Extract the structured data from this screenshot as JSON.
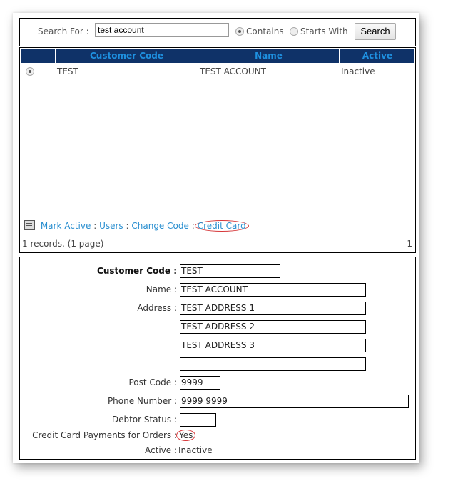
{
  "search": {
    "label": "Search For :",
    "value": "test account",
    "options": [
      {
        "label": "Contains",
        "selected": true
      },
      {
        "label": "Starts With",
        "selected": false
      }
    ],
    "button": "Search"
  },
  "grid": {
    "columns": [
      "Customer Code",
      "Name",
      "Active"
    ],
    "rows": [
      {
        "selected": true,
        "code": "TEST",
        "name": "TEST ACCOUNT",
        "active": "Inactive"
      }
    ],
    "actions": [
      "Mark Active",
      "Users",
      "Change Code",
      "Credit Card"
    ],
    "separator": ":",
    "records": "1 records. (1 page)",
    "page": "1"
  },
  "form": {
    "customer_code": {
      "label": "Customer Code :",
      "value": "TEST"
    },
    "name": {
      "label": "Name :",
      "value": "TEST ACCOUNT"
    },
    "address": {
      "label": "Address :",
      "lines": [
        "TEST ADDRESS 1",
        "TEST ADDRESS 2",
        "TEST ADDRESS 3",
        ""
      ]
    },
    "post_code": {
      "label": "Post Code :",
      "value": "9999"
    },
    "phone": {
      "label": "Phone Number :",
      "value": "9999 9999"
    },
    "debtor_status": {
      "label": "Debtor Status :",
      "value": ""
    },
    "cc_payments": {
      "label": "Credit Card Payments for Orders :",
      "value": "Yes"
    },
    "active": {
      "label": "Active :",
      "value": "Inactive"
    }
  },
  "colors": {
    "header_bg": "#0f3268",
    "header_text": "#1e90e0",
    "link": "#2a8fd0",
    "highlight": "#d6383a"
  }
}
